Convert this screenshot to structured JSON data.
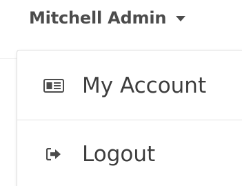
{
  "user_menu": {
    "name": "Mitchell Admin",
    "caret_icon": "caret-down-icon"
  },
  "dropdown": {
    "items": [
      {
        "label": "My Account",
        "icon": "id-card-icon"
      },
      {
        "label": "Logout",
        "icon": "sign-out-icon"
      }
    ]
  },
  "colors": {
    "text": "#4c4c4c",
    "border": "#dcdcdc"
  }
}
